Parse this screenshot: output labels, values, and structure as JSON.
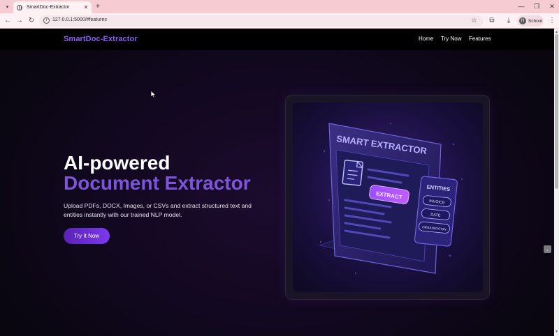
{
  "browser": {
    "tab_title": "SmartDoc-Extractor",
    "tab_close": "✕",
    "new_tab": "+",
    "tab_list": "▾",
    "url": "127.0.0.1:5000/#features",
    "profile_initial": "H",
    "profile_name": "School",
    "window_minimize": "—",
    "window_maximize": "❐",
    "window_close": "✕",
    "back": "←",
    "forward": "→",
    "reload": "↻",
    "star": "☆",
    "extensions": "⧉",
    "download": "⤓",
    "menu": "⋮"
  },
  "site": {
    "brand": "SmartDoc-Extractor",
    "nav": {
      "home": "Home",
      "try_now": "Try Now",
      "features": "Features"
    },
    "hero": {
      "title_line1": "AI-powered",
      "title_line2": "Document Extractor",
      "description": "Upload PDFs, DOCX, Images, or CSVs and extract structured text and entities instantly with our trained NLP model.",
      "cta": "Try It Now"
    },
    "illustration": {
      "heading": "SMART EXTRACTOR",
      "button": "EXTRACT",
      "entities_title": "ENTITIES",
      "entities": [
        "INVOICE",
        "DATE",
        "ORGANIZATION"
      ]
    }
  },
  "colors": {
    "brand_purple": "#8b5cf6",
    "accent_purple": "#7c55d8",
    "tabstrip": "#f6cbd2"
  },
  "icons": {
    "tab_favicon": "globe-icon",
    "site_info": "info-icon",
    "cursor": "mouse-pointer-icon"
  }
}
